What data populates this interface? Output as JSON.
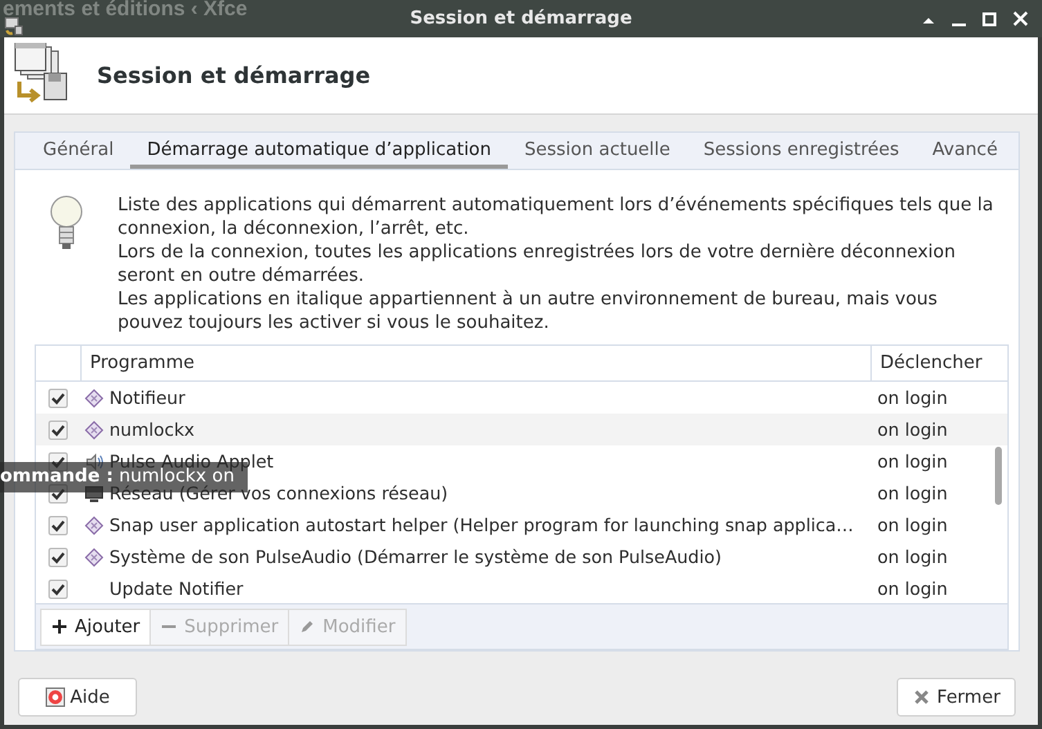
{
  "background_text": "ements et éditions ‹ Xfce",
  "window": {
    "title": "Session et démarrage"
  },
  "header": {
    "title": "Session et démarrage"
  },
  "tabs": [
    {
      "label": "Général",
      "selected": false
    },
    {
      "label": "Démarrage automatique d’application",
      "selected": true
    },
    {
      "label": "Session actuelle",
      "selected": false
    },
    {
      "label": "Sessions enregistrées",
      "selected": false
    },
    {
      "label": "Avancé",
      "selected": false
    }
  ],
  "description": [
    "Liste des applications qui démarrent automatiquement lors d’événements spécifiques tels que la connexion, la déconnexion, l’arrêt, etc.",
    "Lors de la connexion, toutes les applications enregistrées lors de votre dernière déconnexion seront en outre démarrées.",
    "Les applications en italique appartiennent à un autre environnement de bureau, mais vous pouvez toujours les activer si vous le souhaitez."
  ],
  "table": {
    "columns": [
      "Programme",
      "Déclencher"
    ],
    "rows": [
      {
        "checked": true,
        "kind": "diamond",
        "name": "Notifieur",
        "trigger": "on login",
        "hovered": false
      },
      {
        "checked": true,
        "kind": "diamond",
        "name": "numlockx",
        "trigger": "on login",
        "hovered": true
      },
      {
        "checked": true,
        "kind": "speaker",
        "name": "Pulse Audio Applet",
        "trigger": "on login",
        "hovered": false
      },
      {
        "checked": true,
        "kind": "monitor",
        "name": "Réseau (Gérer vos connexions réseau)",
        "trigger": "on login",
        "hovered": false
      },
      {
        "checked": true,
        "kind": "diamond",
        "name": "Snap user application autostart helper (Helper program for launching snap applica…",
        "trigger": "on login",
        "hovered": false
      },
      {
        "checked": true,
        "kind": "diamond",
        "name": "Système de son PulseAudio (Démarrer le système de son PulseAudio)",
        "trigger": "on login",
        "hovered": false
      },
      {
        "checked": true,
        "kind": "plain",
        "name": "Update Notifier",
        "trigger": "on login",
        "hovered": false
      }
    ]
  },
  "toolbar": [
    {
      "kind": "add",
      "label": "Ajouter",
      "disabled": false
    },
    {
      "kind": "remove",
      "label": "Supprimer",
      "disabled": true
    },
    {
      "kind": "edit",
      "label": "Modifier",
      "disabled": true
    }
  ],
  "tooltip": "**ommande :** numlockx on",
  "buttons": [
    {
      "kind": "help",
      "label": "Aide"
    },
    {
      "kind": "close",
      "label": "Fermer"
    }
  ]
}
